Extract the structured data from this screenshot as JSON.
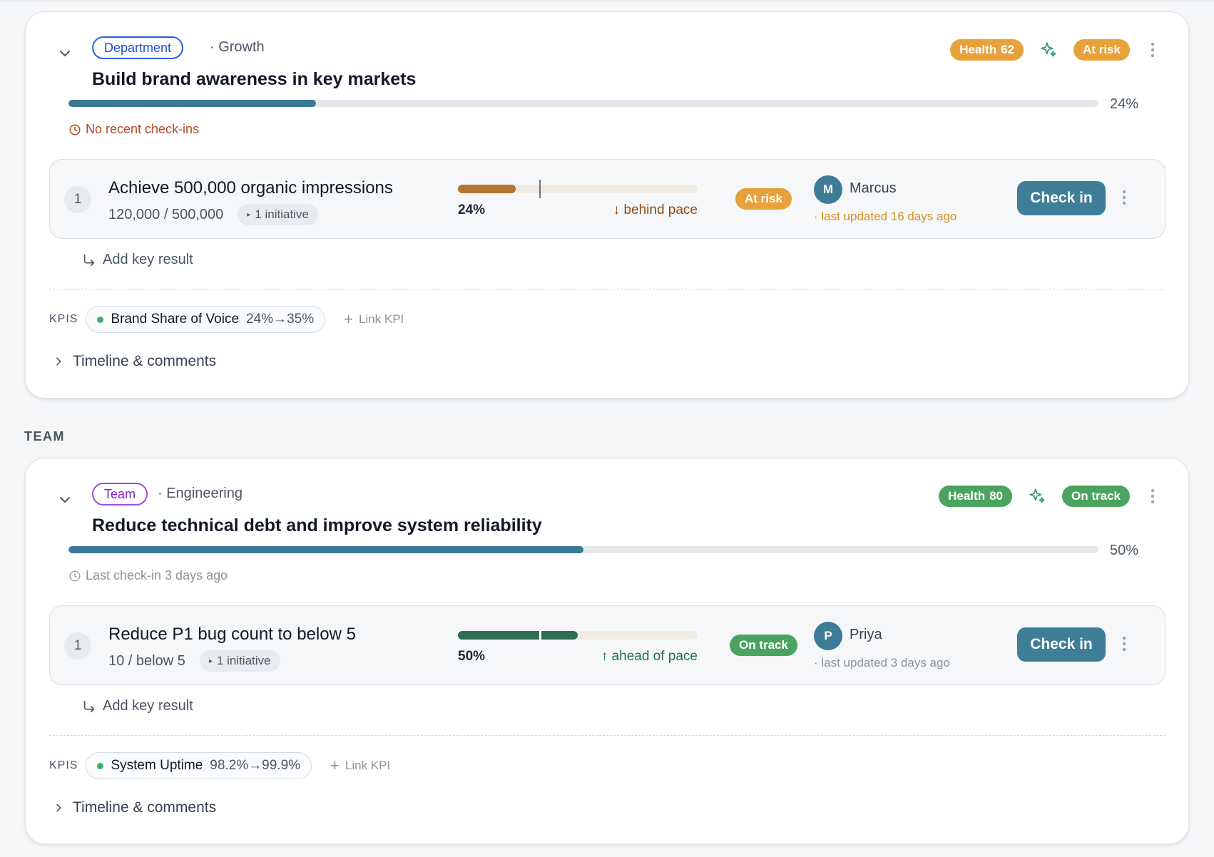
{
  "section_label": "TEAM",
  "objectives": [
    {
      "type_label": "Department",
      "owner": "· Growth",
      "title": "Build brand awareness in key markets",
      "progress_pct": 24,
      "progress_text": "24%",
      "checkin_note": "No recent check-ins",
      "health_label": "Health",
      "health_value": "62",
      "status": "At risk",
      "key_result": {
        "index": "1",
        "title": "Achieve 500,000 organic impressions",
        "progress_text": "120,000 / 500,000",
        "initiatives": "1 initiative",
        "progress_pct": 24,
        "expected_pct": 34,
        "pct_text": "24%",
        "pace": "↓ behind pace",
        "status": "At risk",
        "owner_initial": "M",
        "owner_name": "Marcus",
        "updated": "· last updated 16 days ago",
        "checkin_label": "Check in"
      },
      "add_kr_label": "Add key result",
      "kpis_label": "KPIS",
      "kpi": {
        "name": "Brand Share of Voice",
        "range": "24%→35%"
      },
      "link_kpi_label": "Link KPI",
      "timeline_label": "Timeline & comments"
    },
    {
      "type_label": "Team",
      "owner": "· Engineering",
      "title": "Reduce technical debt and improve system reliability",
      "progress_pct": 50,
      "progress_text": "50%",
      "checkin_note": "Last check-in 3 days ago",
      "health_label": "Health",
      "health_value": "80",
      "status": "On track",
      "key_result": {
        "index": "1",
        "title": "Reduce P1 bug count to below 5",
        "progress_text": "10 / below 5",
        "initiatives": "1 initiative",
        "progress_pct": 50,
        "expected_pct": 34,
        "pct_text": "50%",
        "pace": "↑ ahead of pace",
        "status": "On track",
        "owner_initial": "P",
        "owner_name": "Priya",
        "updated": "· last updated 3 days ago",
        "checkin_label": "Check in"
      },
      "add_kr_label": "Add key result",
      "kpis_label": "KPIS",
      "kpi": {
        "name": "System Uptime",
        "range": "98.2%→99.9%"
      },
      "link_kpi_label": "Link KPI",
      "timeline_label": "Timeline & comments"
    }
  ],
  "colors": {
    "accent": "#3f7e99",
    "at_risk": "#e8a23c",
    "on_track": "#4aa35f",
    "warning_text": "#b4471c"
  }
}
